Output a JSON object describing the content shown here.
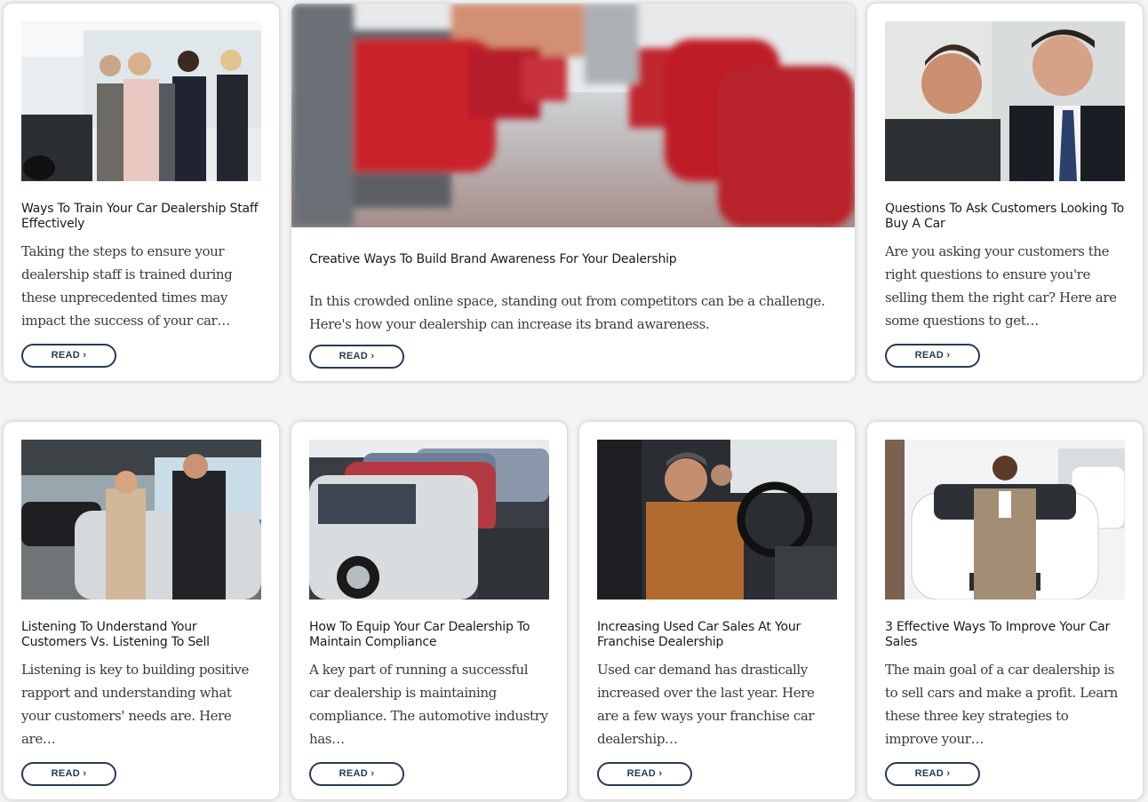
{
  "read_label": "READ ›",
  "colors": {
    "button_border": "#283a52",
    "card_bg": "#ffffff",
    "page_bg": "#f4f4f5"
  },
  "cards": [
    {
      "title": "Ways To Train Your Car Dealership Staff Effectively",
      "excerpt": "Taking the steps to ensure your dealership staff is trained during these unprecedented times may impact the success of your car…",
      "image": "dealership-staff-team-photo"
    },
    {
      "title": "Creative Ways To Build Brand Awareness For Your Dealership",
      "excerpt": "In this crowded online space, standing out from competitors can be a challenge. Here's how your dealership can increase its brand awareness.",
      "image": "blurred-showroom-red-cars-photo"
    },
    {
      "title": "Questions To Ask Customers Looking To Buy A Car",
      "excerpt": "Are you asking your customers the right questions to ensure you're selling them the right car? Here are some questions to get…",
      "image": "salesman-and-customer-photo"
    },
    {
      "title": "Listening To Understand Your Customers Vs. Listening To Sell",
      "excerpt": "Listening is key to building positive rapport and understanding what your customers' needs are. Here are…",
      "image": "couple-with-salesman-photo"
    },
    {
      "title": "How To Equip Your Car Dealership To Maintain Compliance",
      "excerpt": "A key part of running a successful car dealership is maintaining compliance. The automotive industry has…",
      "image": "row-of-cars-lot-photo"
    },
    {
      "title": "Increasing Used Car Sales At Your Franchise Dealership",
      "excerpt": "Used car demand has drastically increased over the last year. Here are a few ways your franchise car dealership…",
      "image": "man-in-driver-seat-photo"
    },
    {
      "title": "3 Effective Ways To Improve Your Car Sales",
      "excerpt": "The main goal of a car dealership is to sell cars and make a profit. Learn these three key strategies to improve your…",
      "image": "salesman-with-white-car-photo"
    }
  ]
}
